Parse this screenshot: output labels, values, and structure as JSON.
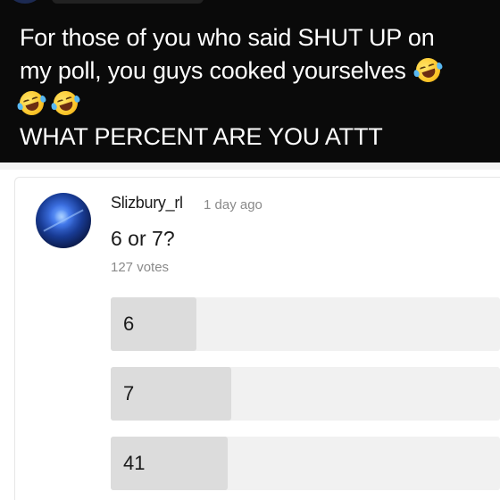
{
  "post": {
    "line1": "For those of you who said SHUT UP on",
    "line2": "my poll, you guys cooked yourselves",
    "line4": "WHAT PERCENT ARE YOU ATTT",
    "emoji_icon": "rolling-on-floor-laughing-emoji"
  },
  "poll": {
    "username": "Slizbury_rl",
    "timestamp": "1 day ago",
    "question": "6 or 7?",
    "votes": "127 votes",
    "options": [
      {
        "label": "6",
        "fraction": 0.22
      },
      {
        "label": "7",
        "fraction": 0.31
      },
      {
        "label": "41",
        "fraction": 0.3
      }
    ]
  },
  "colors": {
    "post_background": "#0a0a0a",
    "post_text": "#ffffff",
    "card_background": "#ffffff",
    "option_track": "#f1f1f1",
    "option_fill": "#dcdcdc",
    "muted_text": "#8a8a8a"
  }
}
